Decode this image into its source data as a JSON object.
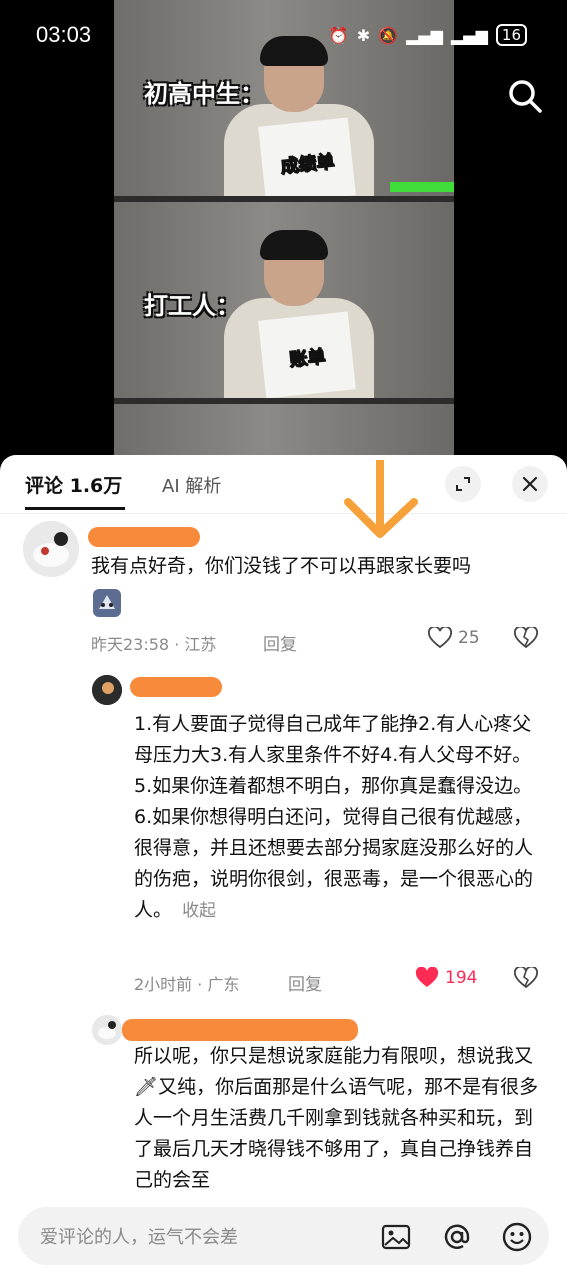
{
  "status": {
    "time": "03:03",
    "battery": "16"
  },
  "video": {
    "panels": [
      {
        "caption": "初高中生：",
        "paper_label": "成绩单"
      },
      {
        "caption": "打工人：",
        "paper_label": "账单"
      }
    ]
  },
  "tabs": {
    "comments_label": "评论 1.6万",
    "ai_label": "AI 解析"
  },
  "comments": [
    {
      "text": "我有点好奇，你们没钱了不可以再跟家长要吗",
      "meta": "昨天23:58 · 江苏",
      "reply_label": "回复",
      "likes": "25",
      "liked": false
    },
    {
      "text": "1.有人要面子觉得自己成年了能挣2.有人心疼父母压力大3.有人家里条件不好4.有人父母不好。5.如果你连着都想不明白，那你真是蠢得没边。6.如果你想得明白还问，觉得自己很有优越感，很得意，并且还想要去部分揭家庭没那么好的人的伤疤，说明你很剑，很恶毒，是一个很恶心的人。",
      "collapse_label": "收起",
      "meta": "2小时前 · 广东",
      "reply_label": "回复",
      "likes": "194",
      "liked": true
    },
    {
      "text": "所以呢，你只是想说家庭能力有限呗，想说我又🗡又纯，你后面那是什么语气呢，那不是有很多人一个月生活费几千刚拿到钱就各种买和玩，到了最后几天才晓得钱不够用了，真自己挣钱养自己的会至"
    }
  ],
  "input": {
    "placeholder": "爱评论的人，运气不会差"
  },
  "colors": {
    "accent_like": "#fe2c55",
    "redaction": "#f88a3c",
    "arrow": "#f7a13a"
  }
}
